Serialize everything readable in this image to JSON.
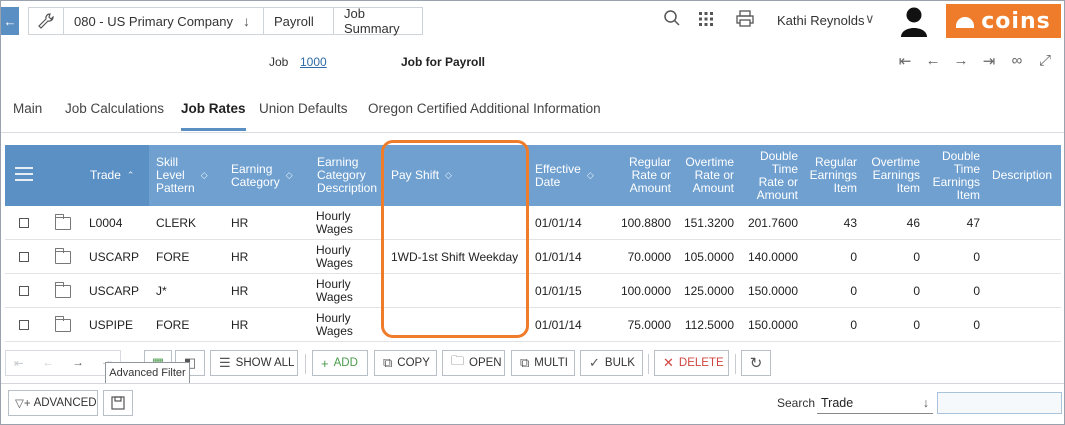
{
  "topbar": {
    "company": "080 - US Primary Company",
    "breadcrumbs": [
      "Payroll",
      "Job Summary"
    ],
    "user": "Kathi Reynolds",
    "logo_text": "coins",
    "brand_color": "#ef7c2a",
    "icons": [
      "back-arrow-icon",
      "wrench-icon",
      "search-icon",
      "app-grid-icon",
      "printer-icon",
      "user-avatar-icon"
    ]
  },
  "job": {
    "label": "Job",
    "value": "1000",
    "title": "Job for Payroll"
  },
  "tabs": [
    {
      "label": "Main"
    },
    {
      "label": "Job Calculations"
    },
    {
      "label": "Job Rates",
      "active": true
    },
    {
      "label": "Union Defaults"
    },
    {
      "label": "Oregon Certified Additional Information"
    }
  ],
  "grid": {
    "header_color": "#6fa0d0",
    "columns": [
      "Trade",
      "Skill Level Pattern",
      "Earning Category",
      "Earning Category Description",
      "Pay Shift",
      "Effective Date",
      "Regular Rate or Amount",
      "Overtime Rate or Amount",
      "Double Time Rate or Amount",
      "Regular Earnings Item",
      "Overtime Earnings Item",
      "Double Time Earnings Item",
      "Description"
    ],
    "col_lines": {
      "skill": [
        "Skill",
        "Level",
        "Pattern"
      ],
      "earncat": [
        "Earning",
        "Category"
      ],
      "earndesc": [
        "Earning",
        "Category",
        "Description"
      ],
      "effdate": [
        "Effective",
        "Date"
      ],
      "regrate": [
        "Regular",
        "Rate or",
        "Amount"
      ],
      "otrate": [
        "Overtime",
        "Rate or",
        "Amount"
      ],
      "dtrate": [
        "Double",
        "Time",
        "Rate or",
        "Amount"
      ],
      "regitem": [
        "Regular",
        "Earnings",
        "Item"
      ],
      "otitem": [
        "Overtime",
        "Earnings",
        "Item"
      ],
      "dtitem": [
        "Double",
        "Time",
        "Earnings",
        "Item"
      ]
    },
    "rows": [
      {
        "trade": "L0004",
        "skill": "CLERK",
        "earncat": "HR",
        "earndesc": [
          "Hourly",
          "Wages"
        ],
        "payshift": "",
        "effdate": "01/01/14",
        "regrate": "100.8800",
        "otrate": "151.3200",
        "dtrate": "201.7600",
        "regitem": "43",
        "otitem": "46",
        "dtitem": "47",
        "desc": ""
      },
      {
        "trade": "USCARP",
        "skill": "FORE",
        "earncat": "HR",
        "earndesc": [
          "Hourly",
          "Wages"
        ],
        "payshift": "1WD-1st Shift Weekday",
        "effdate": "01/01/14",
        "regrate": "70.0000",
        "otrate": "105.0000",
        "dtrate": "140.0000",
        "regitem": "0",
        "otitem": "0",
        "dtitem": "0",
        "desc": ""
      },
      {
        "trade": "USCARP",
        "skill": "J*",
        "earncat": "HR",
        "earndesc": [
          "Hourly",
          "Wages"
        ],
        "payshift": "",
        "effdate": "01/01/15",
        "regrate": "100.0000",
        "otrate": "125.0000",
        "dtrate": "150.0000",
        "regitem": "0",
        "otitem": "0",
        "dtitem": "0",
        "desc": ""
      },
      {
        "trade": "USPIPE",
        "skill": "FORE",
        "earncat": "HR",
        "earndesc": [
          "Hourly",
          "Wages"
        ],
        "payshift": "",
        "effdate": "01/01/14",
        "regrate": "75.0000",
        "otrate": "112.5000",
        "dtrate": "150.0000",
        "regitem": "0",
        "otitem": "0",
        "dtitem": "0",
        "desc": ""
      }
    ]
  },
  "toolbar": {
    "show_all": "SHOW ALL",
    "add": "ADD",
    "copy": "COPY",
    "open": "OPEN",
    "multi": "MULTI",
    "bulk": "BULK",
    "delete": "DELETE",
    "tooltip": "Advanced Filter"
  },
  "bottom": {
    "advanced": "ADVANCED",
    "search_label": "Search",
    "search_field": "Trade",
    "search_value": ""
  }
}
